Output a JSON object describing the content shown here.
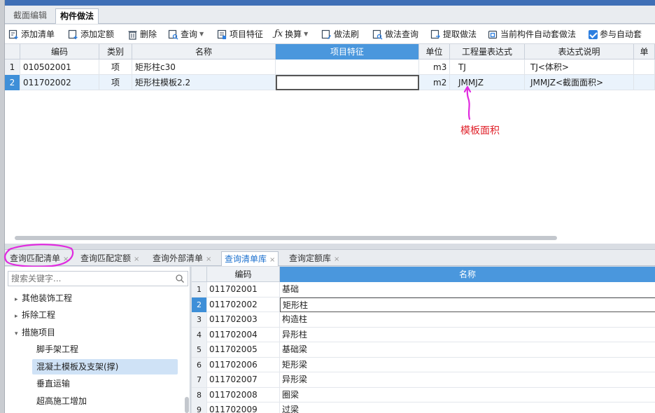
{
  "top_tabs": [
    "截面编辑",
    "构件做法"
  ],
  "toolbar": {
    "add_list": "添加清单",
    "add_quota": "添加定额",
    "delete": "删除",
    "query": "查询",
    "item_feature": "项目特征",
    "convert": "换算",
    "method_brush": "做法刷",
    "method_query": "做法查询",
    "extract_method": "提取做法",
    "auto_apply": "当前构件自动套做法",
    "participate_auto": "参与自动套"
  },
  "main_grid": {
    "headers": [
      "编码",
      "类别",
      "名称",
      "项目特征",
      "单位",
      "工程量表达式",
      "表达式说明",
      "单"
    ],
    "rows": [
      {
        "num": "1",
        "code": "010502001",
        "type": "项",
        "name": "矩形柱c30",
        "feature": "",
        "unit": "m3",
        "expr": "TJ",
        "desc": "TJ<体积>"
      },
      {
        "num": "2",
        "code": "011702002",
        "type": "项",
        "name": "矩形柱模板2.2",
        "feature": "",
        "unit": "m2",
        "expr": "JMMJZ",
        "desc": "JMMJZ<截面面积>"
      }
    ]
  },
  "annotation": {
    "text": "模板面积",
    "color": "#e0212a"
  },
  "bottom_tabs": [
    "查询匹配清单",
    "查询匹配定额",
    "查询外部清单",
    "查询清单库",
    "查询定额库"
  ],
  "search": {
    "placeholder": "搜索关键字..."
  },
  "tree": {
    "items": [
      {
        "label": "其他装饰工程",
        "level": 0,
        "expanded": false
      },
      {
        "label": "拆除工程",
        "level": 0,
        "expanded": false
      },
      {
        "label": "措施项目",
        "level": 0,
        "expanded": true
      },
      {
        "label": "脚手架工程",
        "level": 1
      },
      {
        "label": "混凝土模板及支架(撑)",
        "level": 1,
        "selected": true
      },
      {
        "label": "垂直运输",
        "level": 1
      },
      {
        "label": "超高施工增加",
        "level": 1
      }
    ]
  },
  "bottom_grid": {
    "headers": [
      "编码",
      "名称"
    ],
    "rows": [
      {
        "num": "1",
        "code": "011702001",
        "name": "基础"
      },
      {
        "num": "2",
        "code": "011702002",
        "name": "矩形柱"
      },
      {
        "num": "3",
        "code": "011702003",
        "name": "构造柱"
      },
      {
        "num": "4",
        "code": "011702004",
        "name": "异形柱"
      },
      {
        "num": "5",
        "code": "011702005",
        "name": "基础梁"
      },
      {
        "num": "6",
        "code": "011702006",
        "name": "矩形梁"
      },
      {
        "num": "7",
        "code": "011702007",
        "name": "异形梁"
      },
      {
        "num": "8",
        "code": "011702008",
        "name": "圈梁"
      },
      {
        "num": "9",
        "code": "011702009",
        "name": "过梁"
      }
    ]
  },
  "colors": {
    "accent": "#4a97dd",
    "selected_row": "#3e8fd8",
    "annotation": "#e0212a",
    "highlight_circle": "#e02adf"
  }
}
